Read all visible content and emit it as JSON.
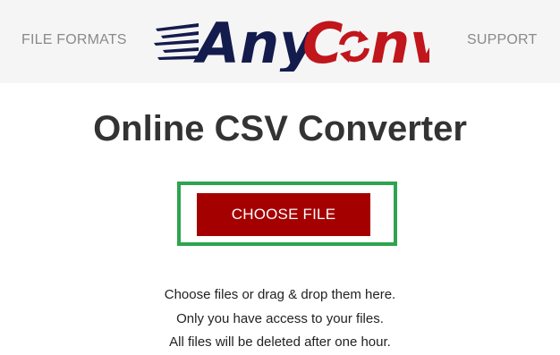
{
  "header": {
    "left_link": "FILE FORMATS",
    "right_link": "SUPPORT",
    "logo": {
      "text_part1": "Any",
      "text_part2_c": "C",
      "text_part2_rest": "nv",
      "color_dark": "#141b4d",
      "color_red": "#c0161c"
    }
  },
  "main": {
    "title": "Online CSV Converter",
    "choose_button": "CHOOSE FILE",
    "highlight_color": "#2ea44f",
    "button_color": "#a50000"
  },
  "info": {
    "lines": [
      "Choose files or drag & drop them here.",
      "Only you have access to your files.",
      "All files will be deleted after one hour."
    ]
  }
}
